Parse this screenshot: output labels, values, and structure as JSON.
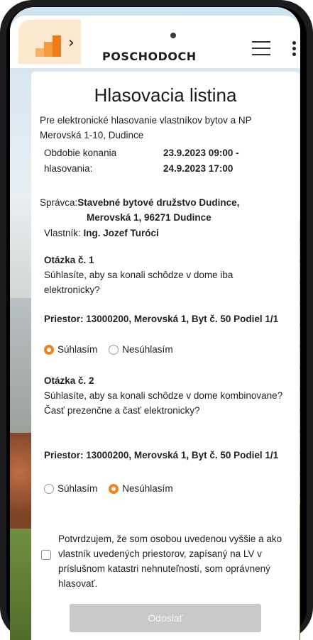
{
  "header": {
    "brand": "POSCHODOCH",
    "logo_icon": "building-steps-logo",
    "menu_icon": "hamburger-icon",
    "more_icon": "kebab-icon"
  },
  "page": {
    "title": "Hlasovacia listina",
    "intro": "Pre elektronické hlasovanie vlastníkov bytov a NP Merovská 1-10, Dudince",
    "period_label": "Obdobie konania hlasovania:",
    "period_value_line1": "23.9.2023 09:00 -",
    "period_value_line2": "24.9.2023 17:00",
    "admin_label": "Správca:",
    "admin_value_line1": "Stavebné bytové družstvo Dudince,",
    "admin_value_line2": "Merovská 1, 96271 Dudince",
    "owner_label": "Vlastník:",
    "owner_value": "Ing. Jozef Turóci"
  },
  "questions": [
    {
      "title": "Otázka č. 1",
      "text": "Súhlasíte, aby sa konali schôdze v dome iba elektronicky?",
      "space": "Priestor: 13000200, Merovská 1, Byt č. 50 Podiel 1/1",
      "option_agree": "Súhlasím",
      "option_disagree": "Nesúhlasím",
      "selected": "agree"
    },
    {
      "title": "Otázka č. 2",
      "text": "Súhlasíte, aby sa konali schôdze v dome kombinovane? Časť prezenčne a časť elektronicky?",
      "space": "Priestor: 13000200, Merovská 1, Byt č. 50 Podiel 1/1",
      "option_agree": "Súhlasím",
      "option_disagree": "Nesúhlasím",
      "selected": "disagree"
    }
  ],
  "confirmation": {
    "text": "Potvrdzujem, že som osobou uvedenou vyššie a ako vlastník uvedených priestorov, zapísaný na LV v príslušnom katastri nehnuteľností, som oprávnený hlasovať.",
    "checked": false
  },
  "submit_label": "Odoslať",
  "colors": {
    "accent": "#f0821e",
    "logo_bg": "#fde7cf",
    "button_disabled": "#c9c9c9"
  }
}
